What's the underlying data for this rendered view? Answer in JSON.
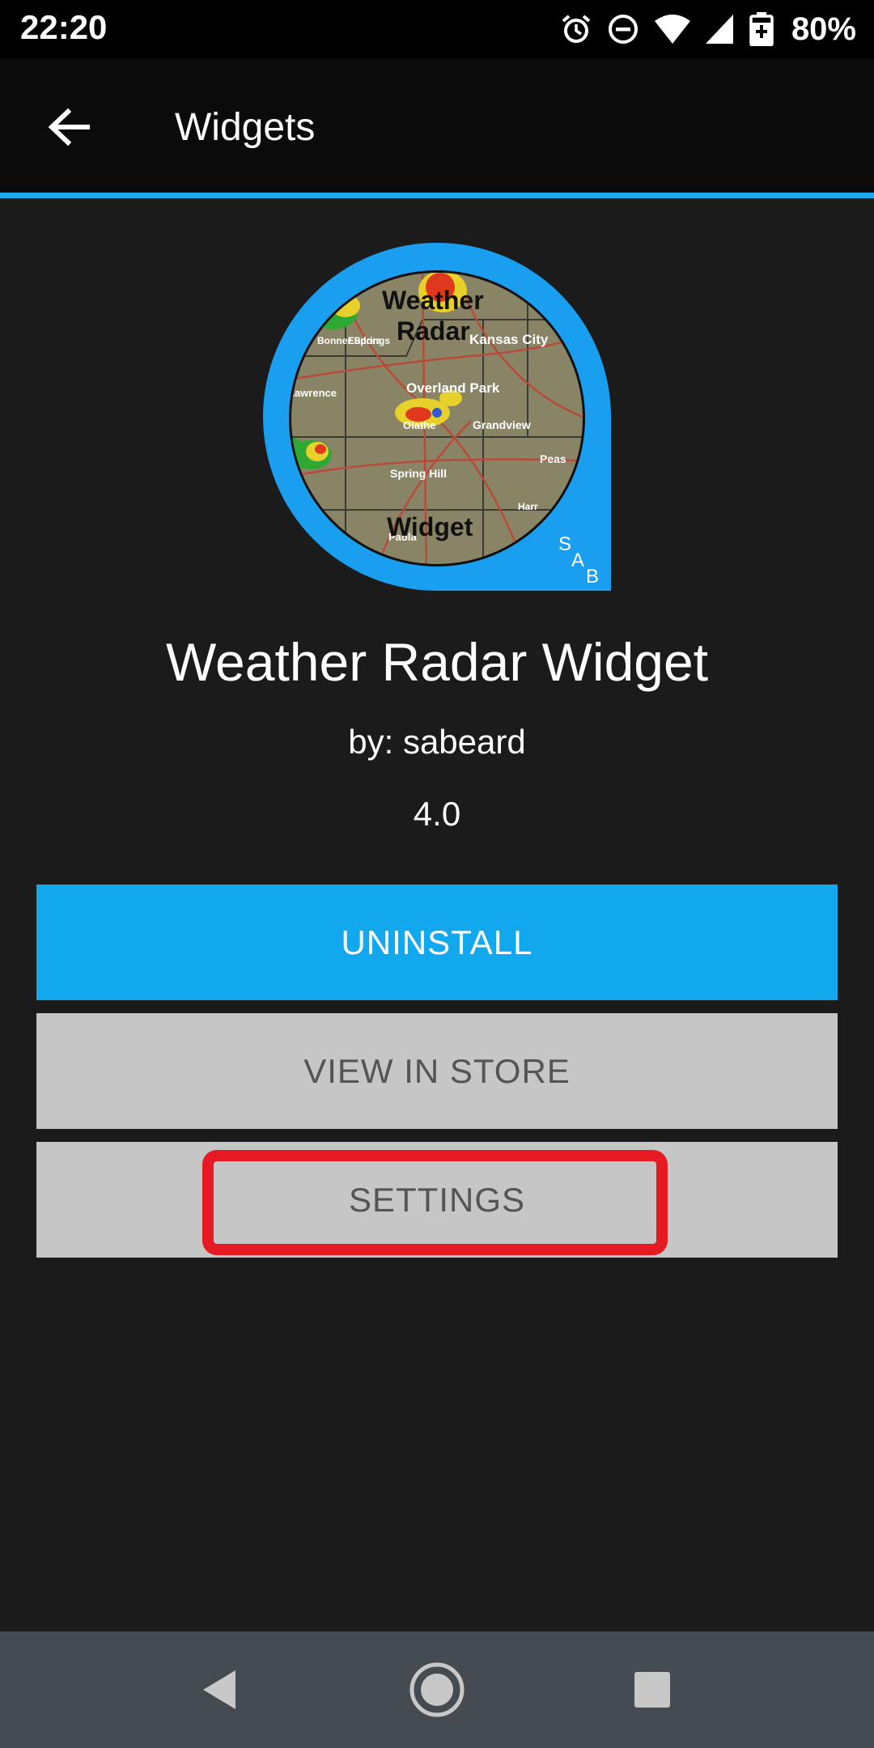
{
  "status_bar": {
    "time": "22:20",
    "battery_percent": "80%",
    "icons": [
      "alarm-icon",
      "do-not-disturb-icon",
      "wifi-icon",
      "signal-icon",
      "battery-charging-icon"
    ]
  },
  "app_bar": {
    "title": "Widgets",
    "back_icon": "arrow-left-icon"
  },
  "app": {
    "icon_text_top": "Weather",
    "icon_text_mid": "Radar",
    "icon_text_bottom": "Widget",
    "icon_badge_s": "S",
    "icon_badge_a": "A",
    "icon_badge_b": "B",
    "map_labels": [
      "Kansas City",
      "Overland Park",
      "Olathe",
      "Grandview",
      "Spring Hill",
      "Paola",
      "Harr",
      "Peas",
      "Lawrence",
      "Eudora",
      "Bonner Springs"
    ],
    "name": "Weather Radar Widget",
    "author": "by: sabeard",
    "version": "4.0"
  },
  "buttons": {
    "uninstall": "UNINSTALL",
    "view_in_store": "VIEW IN STORE",
    "settings": "SETTINGS"
  },
  "nav_bar": {
    "icons": [
      "back-triangle-icon",
      "home-circle-icon",
      "recents-square-icon"
    ]
  },
  "colors": {
    "accent": "#1ea9ee",
    "button_primary": "#12a8ee",
    "button_secondary": "#c6c6c6",
    "highlight": "#e51a23",
    "background": "#1b1b1b",
    "nav_bar": "#444c51"
  }
}
